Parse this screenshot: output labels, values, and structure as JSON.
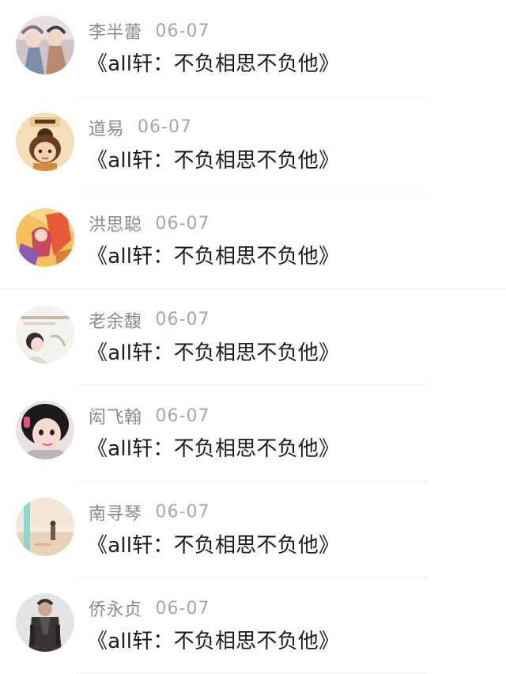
{
  "items": [
    {
      "name": "李半蕾",
      "date": "06-07",
      "message": "《all轩：不负相思不负他》",
      "avatar_icon": "avatar-anime-figures"
    },
    {
      "name": "道易",
      "date": "06-07",
      "message": "《all轩：不负相思不负他》",
      "avatar_icon": "avatar-cartoon-girl"
    },
    {
      "name": "洪思聪",
      "date": "06-07",
      "message": "《all轩：不负相思不负他》",
      "avatar_icon": "avatar-game-hero"
    },
    {
      "name": "老余馥",
      "date": "06-07",
      "message": "《all轩：不负相思不负他》",
      "avatar_icon": "avatar-girl-with-text"
    },
    {
      "name": "闳飞翰",
      "date": "06-07",
      "message": "《all轩：不负相思不负他》",
      "avatar_icon": "avatar-child-portrait"
    },
    {
      "name": "南寻琴",
      "date": "06-07",
      "message": "《all轩：不负相思不负他》",
      "avatar_icon": "avatar-beach-scene"
    },
    {
      "name": "侨永贞",
      "date": "06-07",
      "message": "《all轩：不负相思不负他》",
      "avatar_icon": "avatar-soldier"
    }
  ],
  "colors": {
    "name": "#8a8a8a",
    "date": "#a6a6a6",
    "message": "#1c1c1c",
    "divider": "#f0f0f0"
  }
}
